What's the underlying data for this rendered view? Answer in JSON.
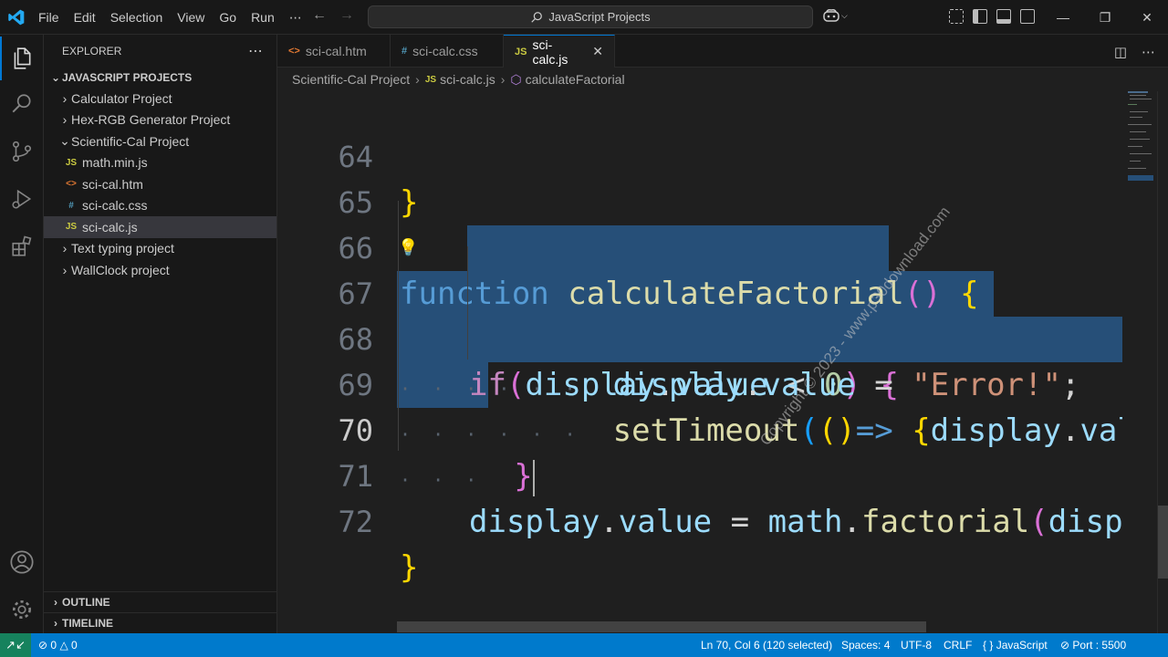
{
  "titlebar": {
    "menu": [
      "File",
      "Edit",
      "Selection",
      "View",
      "Go",
      "Run",
      "⋯"
    ],
    "search": "JavaScript Projects"
  },
  "explorer": {
    "header": "EXPLORER",
    "project": "JAVASCRIPT PROJECTS",
    "items": [
      {
        "label": "Calculator Project",
        "type": "folder",
        "expanded": false
      },
      {
        "label": "Hex-RGB Generator Project",
        "type": "folder",
        "expanded": false
      },
      {
        "label": "Scientific-Cal Project",
        "type": "folder",
        "expanded": true
      },
      {
        "label": "math.min.js",
        "type": "js"
      },
      {
        "label": "sci-cal.htm",
        "type": "html"
      },
      {
        "label": "sci-calc.css",
        "type": "css"
      },
      {
        "label": "sci-calc.js",
        "type": "js",
        "selected": true
      },
      {
        "label": "Text typing project",
        "type": "folder",
        "expanded": false
      },
      {
        "label": "WallClock project",
        "type": "folder",
        "expanded": false
      }
    ],
    "outline": "OUTLINE",
    "timeline": "TIMELINE"
  },
  "tabs": [
    {
      "label": "sci-cal.htm",
      "icon": "<>"
    },
    {
      "label": "sci-calc.css",
      "icon": "#"
    },
    {
      "label": "sci-calc.js",
      "icon": "JS",
      "active": true
    }
  ],
  "breadcrumb": {
    "folder": "Scientific-Cal Project",
    "file": "sci-calc.js",
    "symbol": "calculateFactorial"
  },
  "editor": {
    "line_numbers": [
      "64",
      "65",
      "66",
      "67",
      "68",
      "69",
      "70",
      "71",
      "72"
    ],
    "current_line": "70"
  },
  "statusbar": {
    "errors": "0",
    "warnings": "0",
    "position": "Ln 70, Col 6 (120 selected)",
    "spaces": "Spaces: 4",
    "encoding": "UTF-8",
    "eol": "CRLF",
    "language": "JavaScript",
    "port": "Port : 5500"
  },
  "watermark": "Copyright © 2023 - www.p30download.com",
  "colors": {
    "accent": "#0078d4",
    "statusbar": "#007acc",
    "selection": "#264f78"
  }
}
